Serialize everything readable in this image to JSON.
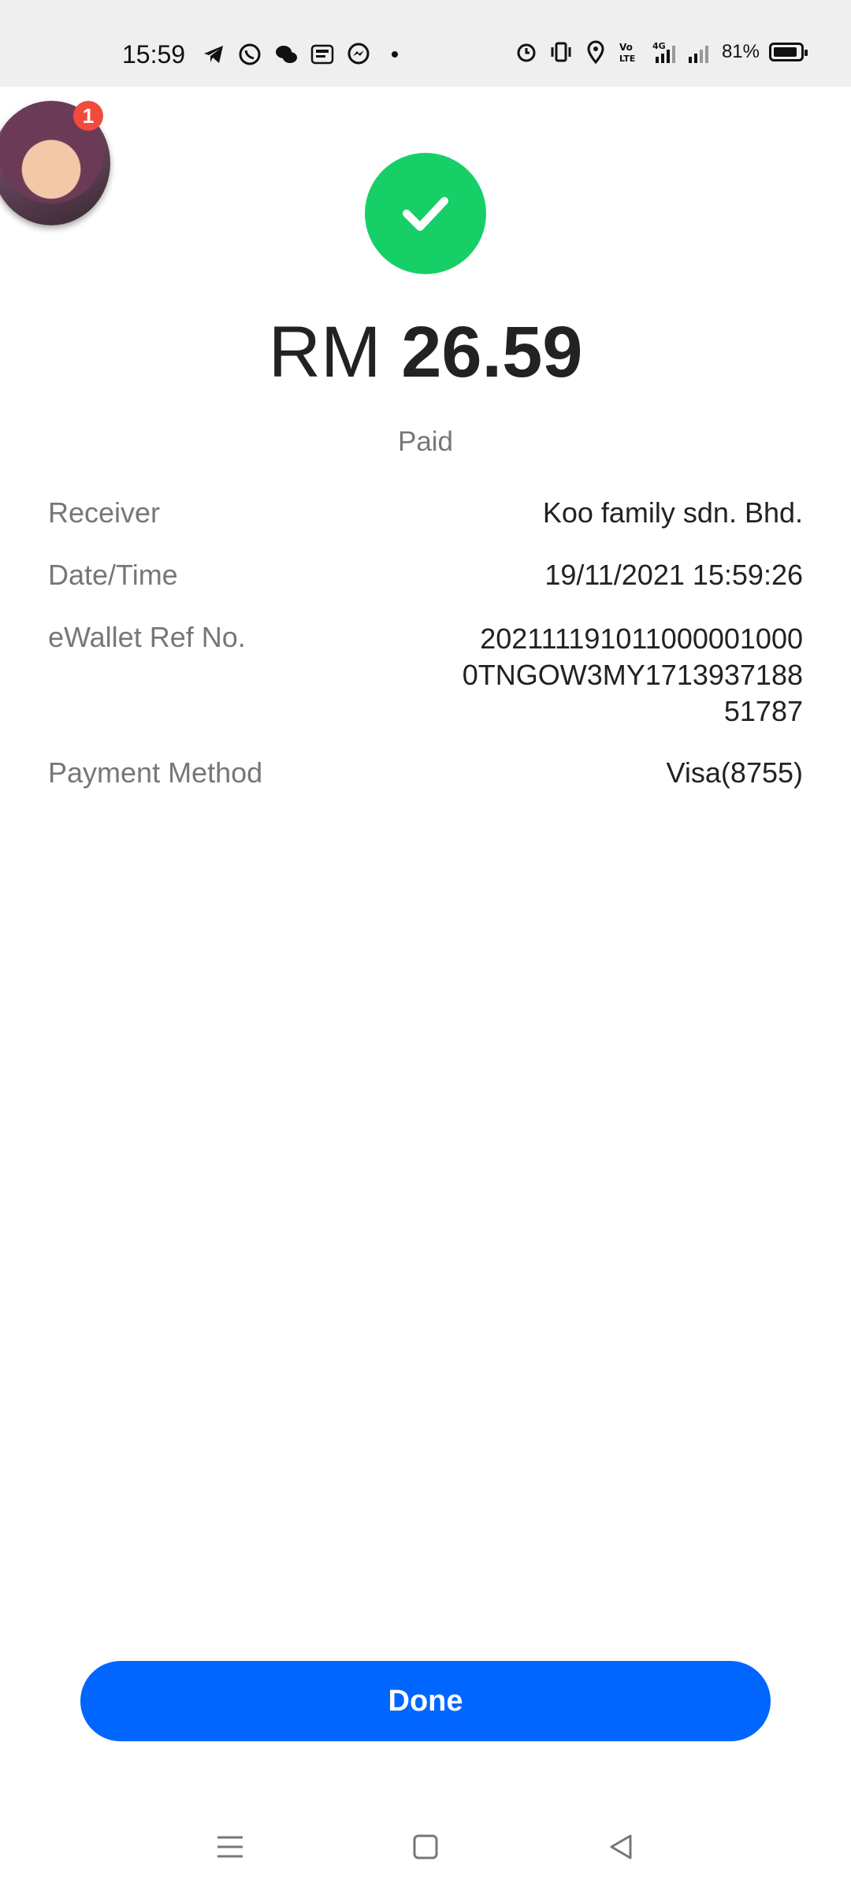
{
  "status_bar": {
    "time": "15:59",
    "battery": "81%",
    "left_icons": [
      "telegram-icon",
      "whatsapp-icon",
      "wechat-icon",
      "touch-n-go-icon",
      "messenger-icon",
      "dot-icon"
    ],
    "right_icons": [
      "alarm-icon",
      "vibrate-icon",
      "location-icon",
      "volte-icon",
      "4g-signal-icon",
      "signal-icon",
      "battery-icon"
    ]
  },
  "avatar": {
    "badge_count": "1"
  },
  "payment": {
    "currency": "RM",
    "amount": "26.59",
    "status": "Paid"
  },
  "details": [
    {
      "label": "Receiver",
      "value": "Koo family sdn. Bhd."
    },
    {
      "label": "Date/Time",
      "value": "19/11/2021 15:59:26"
    },
    {
      "label": "eWallet Ref No.",
      "value": "202111191011000001000 0TNGOW3MY1713937188 51787"
    },
    {
      "label": "Payment Method",
      "value": "Visa(8755)"
    }
  ],
  "ref_lines": [
    "202111191011000001000",
    "0TNGOW3MY1713937188",
    "51787"
  ],
  "done_button": {
    "label": "Done"
  },
  "colors": {
    "success": "#16d067",
    "primary": "#0066ff",
    "badge": "#f24a3f"
  },
  "navigation": [
    "menu-icon",
    "home-icon",
    "back-icon"
  ]
}
